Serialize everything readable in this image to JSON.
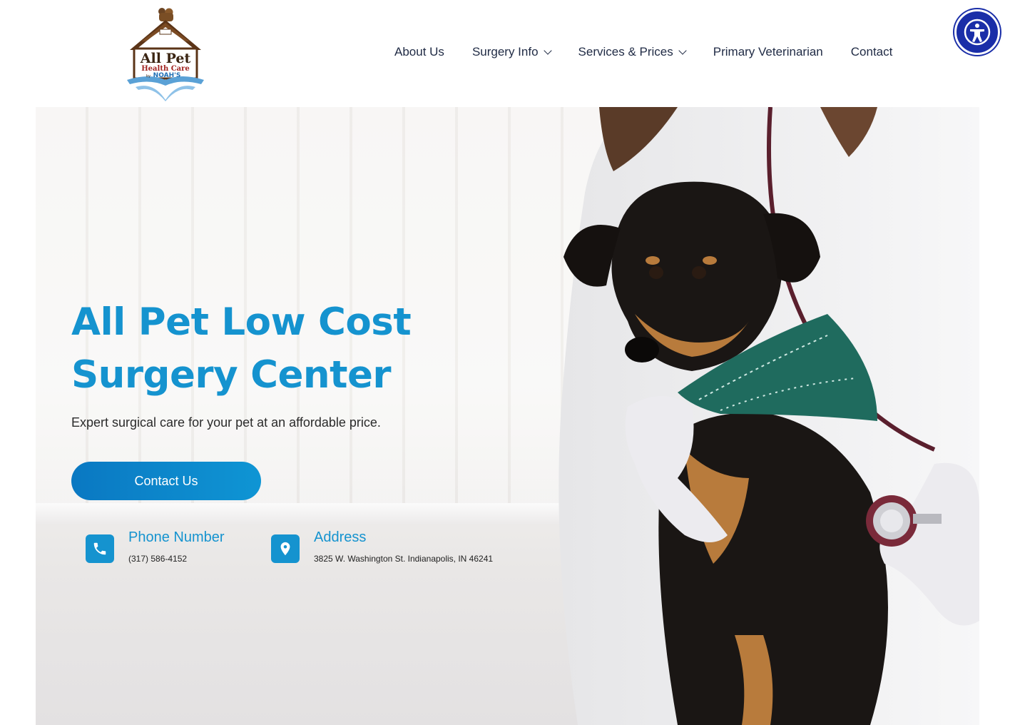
{
  "logo": {
    "line1": "All Pet",
    "line2": "Health Care",
    "line3": "by",
    "line4": "NOAH'S"
  },
  "nav": {
    "items": [
      {
        "label": "About Us",
        "dropdown": false
      },
      {
        "label": "Surgery Info",
        "dropdown": true
      },
      {
        "label": "Services & Prices",
        "dropdown": true
      },
      {
        "label": "Primary Veterinarian",
        "dropdown": false
      },
      {
        "label": "Contact",
        "dropdown": false
      }
    ]
  },
  "accessibility": {
    "icon": "accessibility-icon"
  },
  "hero": {
    "title": "All Pet Low Cost Surgery Center",
    "subtitle": "Expert surgical care for your pet at an affordable price.",
    "cta_label": "Contact Us"
  },
  "contact": {
    "phone": {
      "title": "Phone Number",
      "value": "(317) 586-4152",
      "icon": "phone-icon"
    },
    "address": {
      "title": "Address",
      "value": "3825 W. Washington St. Indianapolis, IN 46241",
      "icon": "map-pin-icon"
    }
  },
  "colors": {
    "accent": "#1593cf",
    "cta": "#0a78c2",
    "nav_text": "#1f2a44",
    "a11y": "#1a2ea8"
  }
}
